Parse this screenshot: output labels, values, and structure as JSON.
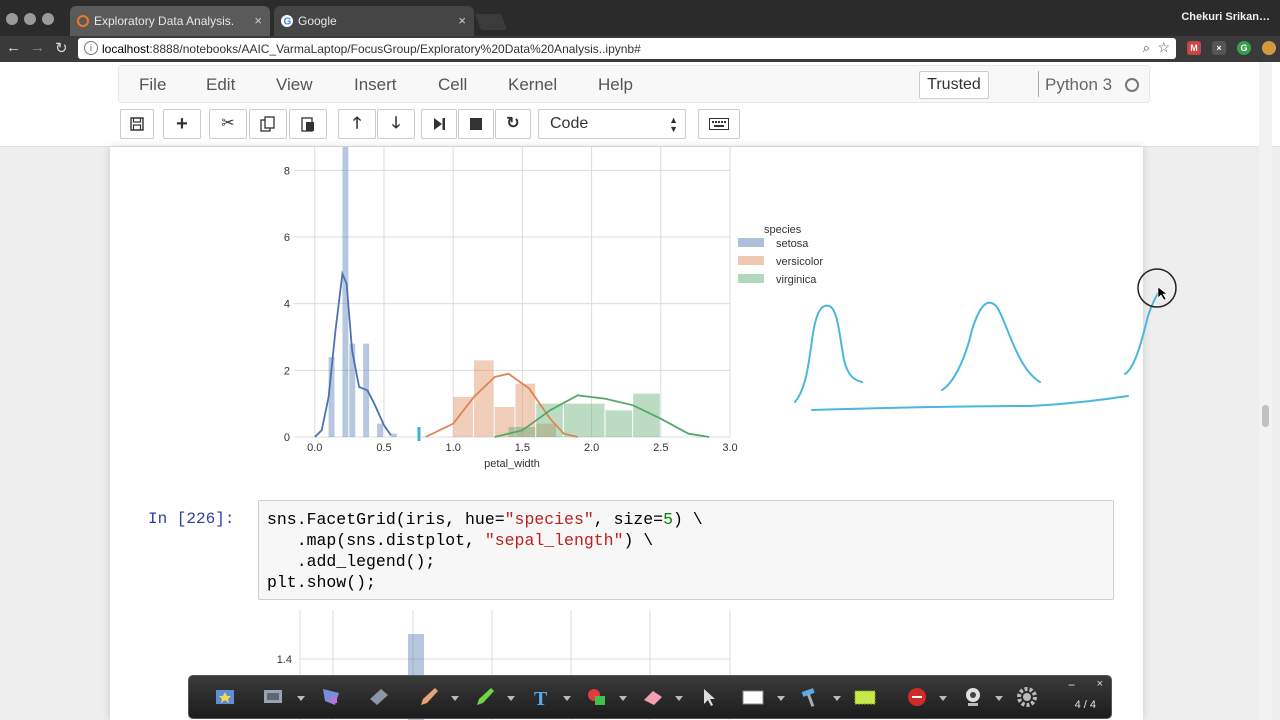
{
  "browser": {
    "tabs": [
      {
        "title": "Exploratory Data Analysis.",
        "close": "×"
      },
      {
        "title": "Google",
        "close": "×"
      }
    ],
    "profile": "Chekuri Srikan…",
    "url_prefix": "localhost",
    "url_rest": ":8888/notebooks/AAIC_VarmaLaptop/FocusGroup/Exploratory%20Data%20Analysis..ipynb#"
  },
  "jupyter": {
    "menu": [
      "File",
      "Edit",
      "View",
      "Insert",
      "Cell",
      "Kernel",
      "Help"
    ],
    "trusted": "Trusted",
    "kernel": "Python 3",
    "cell_type": "Code",
    "colors": {
      "prompt": "#303f9f",
      "string": "#ba2121",
      "number": "#008800"
    }
  },
  "cell": {
    "prompt": "In [226]:",
    "lines": [
      [
        "sns.FacetGrid(iris, hue=",
        "\"species\"",
        ", size=",
        "5",
        ") \\"
      ],
      [
        "   .map(sns.distplot, ",
        "\"sepal_length\"",
        ") \\"
      ],
      [
        "   .add_legend();"
      ],
      [
        "plt.show();"
      ]
    ]
  },
  "chart_data": [
    {
      "type": "bar",
      "xlabel": "petal_width",
      "ylabel": "",
      "xlim": [
        -0.15,
        3.0
      ],
      "ylim": [
        0,
        8.7
      ],
      "xticks": [
        "0.0",
        "0.5",
        "1.0",
        "1.5",
        "2.0",
        "2.5",
        "3.0"
      ],
      "yticks": [
        "0",
        "2",
        "4",
        "6",
        "8"
      ],
      "legend_title": "species",
      "legend_position": "right",
      "grid": true,
      "series": [
        {
          "name": "setosa",
          "color": "#4c72b0",
          "bins": [
            [
              0.1,
              0.15,
              2.4
            ],
            [
              0.15,
              0.2,
              0.0
            ],
            [
              0.2,
              0.25,
              8.7
            ],
            [
              0.25,
              0.3,
              2.8
            ],
            [
              0.3,
              0.35,
              0.0
            ],
            [
              0.35,
              0.4,
              2.8
            ],
            [
              0.4,
              0.45,
              0.0
            ],
            [
              0.45,
              0.5,
              0.4
            ],
            [
              0.5,
              0.55,
              0.0
            ],
            [
              0.55,
              0.6,
              0.1
            ]
          ],
          "kde": [
            [
              0.0,
              0.0
            ],
            [
              0.05,
              0.2
            ],
            [
              0.1,
              1.2
            ],
            [
              0.15,
              3.2
            ],
            [
              0.2,
              4.9
            ],
            [
              0.23,
              4.6
            ],
            [
              0.27,
              2.6
            ],
            [
              0.32,
              1.5
            ],
            [
              0.38,
              1.4
            ],
            [
              0.43,
              1.0
            ],
            [
              0.5,
              0.35
            ],
            [
              0.55,
              0.05
            ]
          ]
        },
        {
          "name": "versicolor",
          "color": "#dd8452",
          "bins": [
            [
              1.0,
              1.15,
              1.2
            ],
            [
              1.15,
              1.3,
              2.3
            ],
            [
              1.3,
              1.45,
              0.9
            ],
            [
              1.45,
              1.6,
              1.6
            ],
            [
              1.6,
              1.75,
              0.4
            ]
          ],
          "kde": [
            [
              0.8,
              0.0
            ],
            [
              1.0,
              0.4
            ],
            [
              1.15,
              1.2
            ],
            [
              1.3,
              1.8
            ],
            [
              1.4,
              1.9
            ],
            [
              1.55,
              1.45
            ],
            [
              1.7,
              0.55
            ],
            [
              1.8,
              0.1
            ],
            [
              1.9,
              0.0
            ]
          ]
        },
        {
          "name": "virginica",
          "color": "#55a868",
          "bins": [
            [
              1.4,
              1.6,
              0.3
            ],
            [
              1.6,
              1.8,
              1.0
            ],
            [
              1.8,
              2.1,
              1.0
            ],
            [
              2.1,
              2.3,
              0.8
            ],
            [
              2.3,
              2.5,
              1.3
            ]
          ],
          "kde": [
            [
              1.3,
              0.0
            ],
            [
              1.5,
              0.2
            ],
            [
              1.7,
              0.8
            ],
            [
              1.9,
              1.25
            ],
            [
              2.1,
              1.15
            ],
            [
              2.3,
              0.95
            ],
            [
              2.5,
              0.55
            ],
            [
              2.7,
              0.1
            ],
            [
              2.85,
              0.0
            ]
          ]
        }
      ]
    },
    {
      "type": "bar",
      "yticks": [
        "1.4"
      ],
      "grid": true,
      "series": [
        {
          "name": "",
          "color": "#4c72b0",
          "bins": [],
          "kde": []
        }
      ]
    }
  ],
  "annotation_toolbar": {
    "page": "4 / 4",
    "min": "−",
    "close": "×"
  }
}
